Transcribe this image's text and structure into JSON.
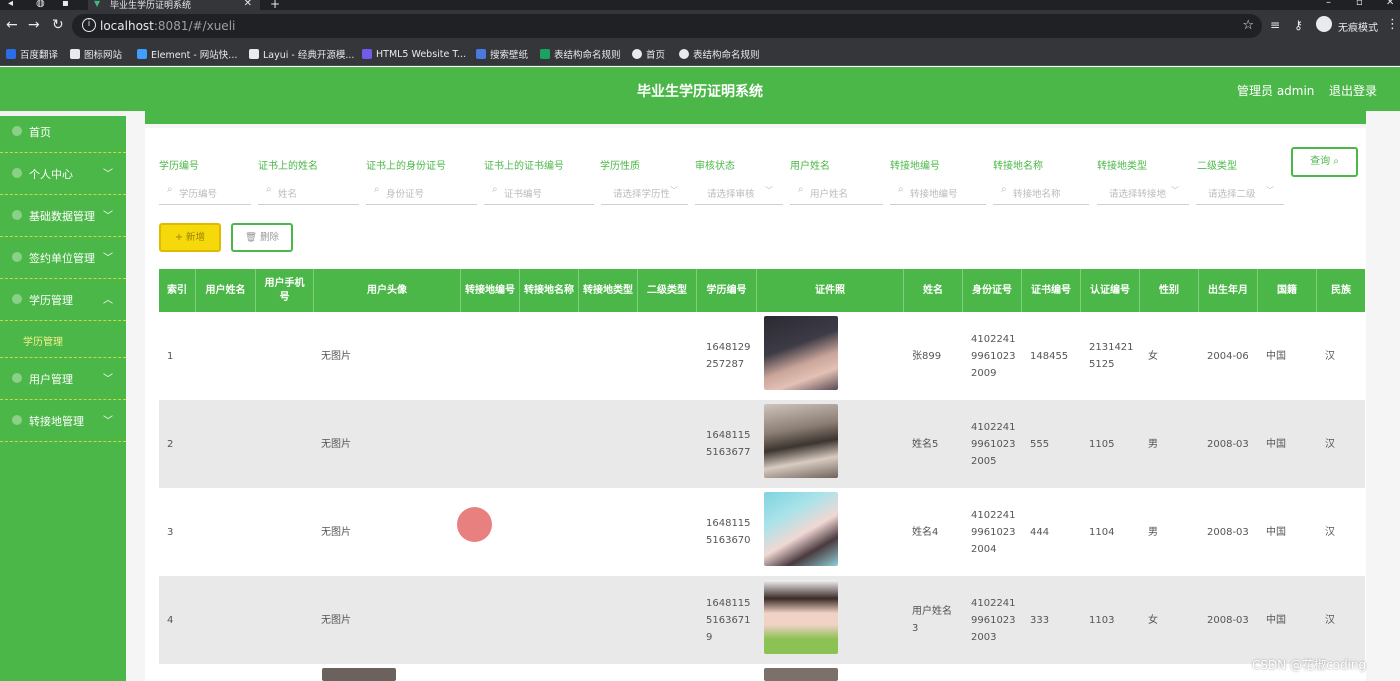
{
  "browser": {
    "tab_title": "毕业生学历证明系统",
    "url_host": "localhost",
    "url_rest": ":8081/#/xueli",
    "profile_label": "无痕模式",
    "bookmarks": [
      {
        "label": "百度翻译",
        "color": "#2b6de8"
      },
      {
        "label": "图标网站",
        "color": "#e8eaed"
      },
      {
        "label": "Element - 网站快...",
        "color": "#409eff"
      },
      {
        "label": "Layui - 经典开源模...",
        "color": "#e8eaed"
      },
      {
        "label": "HTML5 Website T...",
        "color": "#6f5ce8"
      },
      {
        "label": "搜索壁纸",
        "color": "#4a7ae0"
      },
      {
        "label": "表结构命名规则",
        "color": "#1aa260"
      },
      {
        "label": "首页",
        "color": "#e8eaed"
      },
      {
        "label": "表结构命名规则",
        "color": "#e8eaed"
      }
    ]
  },
  "header": {
    "title": "毕业生学历证明系统",
    "admin": "管理员 admin",
    "logout": "退出登录"
  },
  "sidebar": {
    "items": [
      {
        "label": "首页",
        "chevron": ""
      },
      {
        "label": "个人中心",
        "chevron": "﹀"
      },
      {
        "label": "基础数据管理",
        "chevron": "﹀"
      },
      {
        "label": "签约单位管理",
        "chevron": "﹀"
      },
      {
        "label": "学历管理",
        "chevron": "︿"
      },
      {
        "label": "用户管理",
        "chevron": "﹀"
      },
      {
        "label": "转接地管理",
        "chevron": "﹀"
      }
    ],
    "sub_item": "学历管理"
  },
  "filters": [
    {
      "label": "学历编号",
      "placeholder": "学历编号",
      "type": "text"
    },
    {
      "label": "证书上的姓名",
      "placeholder": "姓名",
      "type": "text"
    },
    {
      "label": "证书上的身份证号",
      "placeholder": "身份证号",
      "type": "text"
    },
    {
      "label": "证书上的证书编号",
      "placeholder": "证书编号",
      "type": "text"
    },
    {
      "label": "学历性质",
      "placeholder": "请选择学历性",
      "type": "select"
    },
    {
      "label": "审核状态",
      "placeholder": "请选择审核",
      "type": "select"
    },
    {
      "label": "用户姓名",
      "placeholder": "用户姓名",
      "type": "text"
    },
    {
      "label": "转接地编号",
      "placeholder": "转接地编号",
      "type": "text"
    },
    {
      "label": "转接地名称",
      "placeholder": "转接地名称",
      "type": "text"
    },
    {
      "label": "转接地类型",
      "placeholder": "请选择转接地",
      "type": "select"
    },
    {
      "label": "二级类型",
      "placeholder": "请选择二级",
      "type": "select"
    }
  ],
  "buttons": {
    "query": "查询",
    "add": "+ 新增",
    "delete": "删除"
  },
  "table": {
    "columns": [
      "索引",
      "用户姓名",
      "用户手机号",
      "用户头像",
      "转接地编号",
      "转接地名称",
      "转接地类型",
      "二级类型",
      "学历编号",
      "证件照",
      "姓名",
      "身份证号",
      "证书编号",
      "认证编号",
      "性别",
      "出生年月",
      "国籍",
      "民族"
    ],
    "rows": [
      {
        "index": "1",
        "avatar": "无图片",
        "xueli_no": "1648129\n257287",
        "name": "张899",
        "id_no": "4102241\n9961023\n2009",
        "cert_no": "148455",
        "auth_no": "2131421\n5125",
        "gender": "女",
        "birth": "2004-06",
        "nation": "中国",
        "ethnic": "汉"
      },
      {
        "index": "2",
        "avatar": "无图片",
        "xueli_no": "1648115\n5163677",
        "name": "姓名5",
        "id_no": "4102241\n9961023\n2005",
        "cert_no": "555",
        "auth_no": "1105",
        "gender": "男",
        "birth": "2008-03",
        "nation": "中国",
        "ethnic": "汉"
      },
      {
        "index": "3",
        "avatar": "无图片",
        "xueli_no": "1648115\n5163670",
        "name": "姓名4",
        "id_no": "4102241\n9961023\n2004",
        "cert_no": "444",
        "auth_no": "1104",
        "gender": "男",
        "birth": "2008-03",
        "nation": "中国",
        "ethnic": "汉"
      },
      {
        "index": "4",
        "avatar": "无图片",
        "xueli_no": "1648115\n5163671\n9",
        "name": "用户姓名\n3",
        "id_no": "4102241\n9961023\n2003",
        "cert_no": "333",
        "auth_no": "1103",
        "gender": "女",
        "birth": "2008-03",
        "nation": "中国",
        "ethnic": "汉"
      }
    ]
  },
  "watermark": "CSDN @花椒coding"
}
